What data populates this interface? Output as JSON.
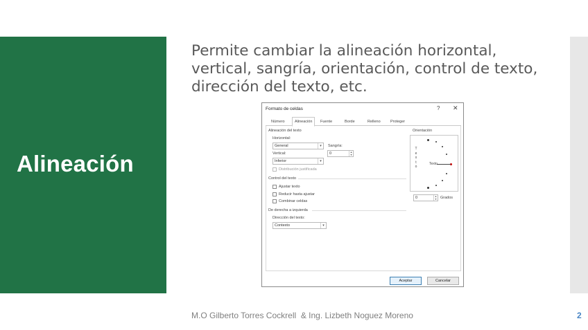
{
  "slide": {
    "title": "Alineación",
    "body": "Permite cambiar la alineación horizontal, vertical, sangría, orientación, control de texto, dirección del texto, etc.",
    "footer": "M.O Gilberto Torres Cockrell  & Ing. Lizbeth Noguez Moreno",
    "page_number": "2",
    "colors": {
      "accent_panel": "#217346",
      "side_strip": "#e7e7e7",
      "page_number": "#4a86c5",
      "body_text": "#595959"
    }
  },
  "dialog": {
    "title": "Formato de celdas",
    "help": "?",
    "close": "✕",
    "tabs": [
      "Número",
      "Alineación",
      "Fuente",
      "Borde",
      "Relleno",
      "Proteger"
    ],
    "active_tab": "Alineación",
    "alignment_section": "Alineación del texto",
    "horizontal_label": "Horizontal:",
    "horizontal_value": "General",
    "indent_label": "Sangría:",
    "indent_value": "0",
    "vertical_label": "Vertical:",
    "vertical_value": "Inferior",
    "distributed": "Distribución justificada",
    "text_control_section": "Control del texto",
    "wrap_text": "Ajustar texto",
    "shrink_to_fit": "Reducir hasta ajustar",
    "merge_cells": "Combinar celdas",
    "rtl_section": "De derecha a izquierda",
    "direction_label": "Dirección del texto:",
    "direction_value": "Contexto",
    "orientation_label": "Orientación",
    "vertical_text_letters": [
      "T",
      "e",
      "x",
      "t",
      "o"
    ],
    "orientation_text": "Texto",
    "degrees_value": "0",
    "degrees_label": "Grados",
    "ok": "Aceptar",
    "cancel": "Cancelar"
  }
}
